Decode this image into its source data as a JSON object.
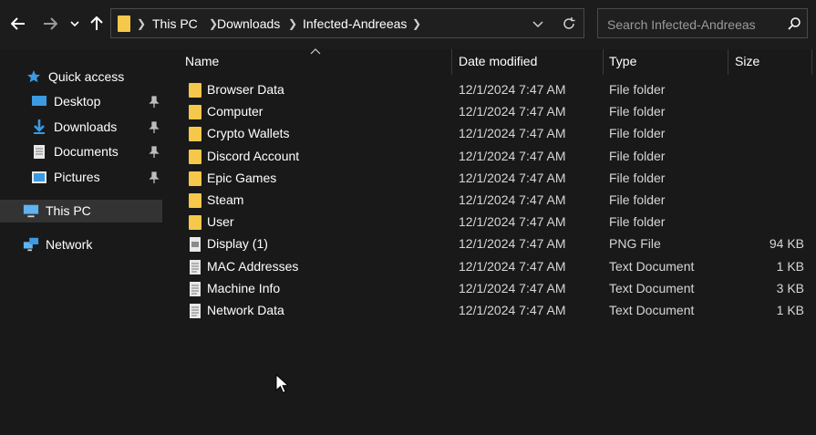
{
  "toolbar": {
    "back_icon": "arrow-left-icon",
    "forward_icon": "arrow-right-icon",
    "recent_icon": "chevron-down-icon",
    "up_icon": "arrow-up-icon"
  },
  "address": {
    "breadcrumbs": [
      "This PC",
      "Downloads",
      "Infected-Andreeas"
    ]
  },
  "search": {
    "placeholder": "Search Infected-Andreeas"
  },
  "sidebar": {
    "items": [
      {
        "label": "Quick access",
        "icon": "star-icon"
      },
      {
        "label": "Desktop",
        "icon": "desktop-icon",
        "pinned": true
      },
      {
        "label": "Downloads",
        "icon": "download-icon",
        "pinned": true
      },
      {
        "label": "Documents",
        "icon": "document-icon",
        "pinned": true
      },
      {
        "label": "Pictures",
        "icon": "pictures-icon",
        "pinned": true
      },
      {
        "label": "This PC",
        "icon": "computer-icon",
        "selected": true
      },
      {
        "label": "Network",
        "icon": "network-icon"
      }
    ]
  },
  "columns": {
    "name": "Name",
    "date": "Date modified",
    "type": "Type",
    "size": "Size"
  },
  "files": [
    {
      "name": "Browser Data",
      "date": "12/1/2024 7:47 AM",
      "type": "File folder",
      "size": "",
      "icon": "folder-icon"
    },
    {
      "name": "Computer",
      "date": "12/1/2024 7:47 AM",
      "type": "File folder",
      "size": "",
      "icon": "folder-icon"
    },
    {
      "name": "Crypto Wallets",
      "date": "12/1/2024 7:47 AM",
      "type": "File folder",
      "size": "",
      "icon": "folder-icon"
    },
    {
      "name": "Discord Account",
      "date": "12/1/2024 7:47 AM",
      "type": "File folder",
      "size": "",
      "icon": "folder-icon"
    },
    {
      "name": "Epic Games",
      "date": "12/1/2024 7:47 AM",
      "type": "File folder",
      "size": "",
      "icon": "folder-icon"
    },
    {
      "name": "Steam",
      "date": "12/1/2024 7:47 AM",
      "type": "File folder",
      "size": "",
      "icon": "folder-icon"
    },
    {
      "name": "User",
      "date": "12/1/2024 7:47 AM",
      "type": "File folder",
      "size": "",
      "icon": "folder-icon"
    },
    {
      "name": "Display (1)",
      "date": "12/1/2024 7:47 AM",
      "type": "PNG File",
      "size": "94 KB",
      "icon": "image-file-icon"
    },
    {
      "name": "MAC Addresses",
      "date": "12/1/2024 7:47 AM",
      "type": "Text Document",
      "size": "1 KB",
      "icon": "text-file-icon"
    },
    {
      "name": "Machine Info",
      "date": "12/1/2024 7:47 AM",
      "type": "Text Document",
      "size": "3 KB",
      "icon": "text-file-icon"
    },
    {
      "name": "Network Data",
      "date": "12/1/2024 7:47 AM",
      "type": "Text Document",
      "size": "1 KB",
      "icon": "text-file-icon"
    }
  ],
  "colors": {
    "background": "#191919",
    "folder": "#f5c84c",
    "accent": "#3b9ae1",
    "selected": "#333333"
  }
}
